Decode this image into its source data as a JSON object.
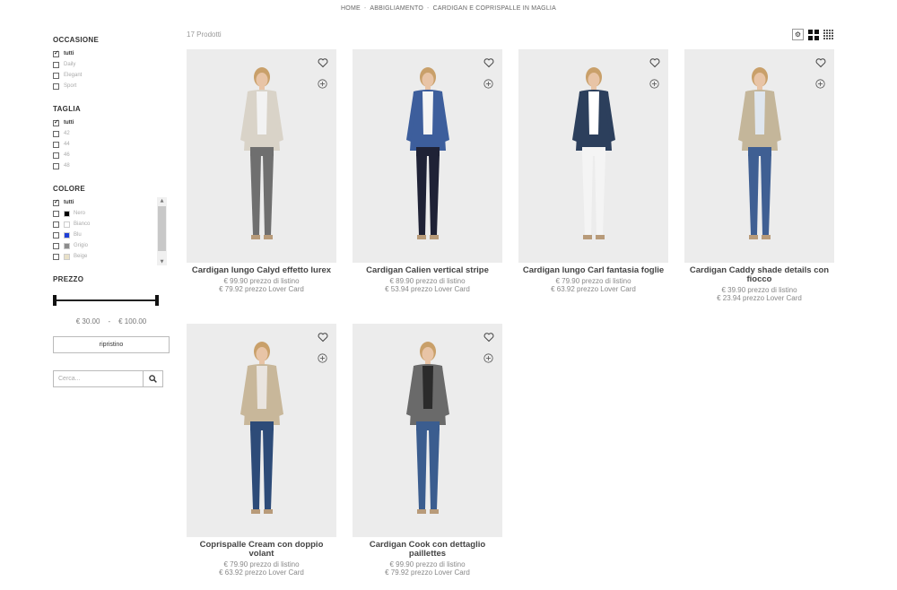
{
  "breadcrumb": [
    "HOME",
    "ABBIGLIAMENTO",
    "CARDIGAN E COPRISPALLE IN MAGLIA"
  ],
  "filters": {
    "occasione": {
      "title": "OCCASIONE",
      "options": [
        {
          "label": "tutti",
          "checked": true
        },
        {
          "label": "Daily",
          "checked": false
        },
        {
          "label": "Elegant",
          "checked": false
        },
        {
          "label": "Sport",
          "checked": false
        }
      ]
    },
    "taglia": {
      "title": "TAGLIA",
      "options": [
        {
          "label": "tutti",
          "checked": true
        },
        {
          "label": "42",
          "checked": false
        },
        {
          "label": "44",
          "checked": false
        },
        {
          "label": "46",
          "checked": false
        },
        {
          "label": "48",
          "checked": false
        }
      ]
    },
    "colore": {
      "title": "COLORE",
      "options": [
        {
          "label": "tutti",
          "checked": true,
          "swatch": null
        },
        {
          "label": "Nero",
          "checked": false,
          "swatch": "#000000"
        },
        {
          "label": "Bianco",
          "checked": false,
          "swatch": "#ffffff"
        },
        {
          "label": "Blu",
          "checked": false,
          "swatch": "#1f3fd6"
        },
        {
          "label": "Grigio",
          "checked": false,
          "swatch": "#8c8c8c"
        },
        {
          "label": "Beige",
          "checked": false,
          "swatch": "#e9e1c8"
        }
      ]
    },
    "prezzo": {
      "title": "PREZZO",
      "min": "€ 30.00",
      "max": "€ 100.00",
      "dash": "-"
    }
  },
  "reset_label": "ripristino",
  "search": {
    "placeholder": "Cerca..."
  },
  "count_label": "17 Prodotti",
  "products": [
    {
      "name": "Cardigan lungo Calyd effetto lurex",
      "list_price": "€ 99.90 prezzo di listino",
      "card_price": "€ 79.92 prezzo Lover Card",
      "top": "#d9d3c8",
      "inner": "#f2f2f2",
      "pants": "#6f6f6f"
    },
    {
      "name": "Cardigan Calien vertical stripe",
      "list_price": "€ 89.90 prezzo di listino",
      "card_price": "€ 53.94 prezzo Lover Card",
      "top": "#3d5e9c",
      "inner": "#f5f5f5",
      "pants": "#1f2236"
    },
    {
      "name": "Cardigan lungo Carl fantasia foglie",
      "list_price": "€ 79.90 prezzo di listino",
      "card_price": "€ 63.92 prezzo Lover Card",
      "top": "#2c3f5c",
      "inner": "#ffffff",
      "pants": "#f4f4f4"
    },
    {
      "name": "Cardigan Caddy shade details con fiocco",
      "list_price": "€ 39.90 prezzo di listino",
      "card_price": "€ 23.94 prezzo Lover Card",
      "top": "#c4b69a",
      "inner": "#dfe6ee",
      "pants": "#3f5f93"
    },
    {
      "name": "Coprispalle Cream con doppio volant",
      "list_price": "€ 79.90 prezzo di listino",
      "card_price": "€ 63.92 prezzo Lover Card",
      "top": "#c8b79a",
      "inner": "#e9e4df",
      "pants": "#2d4b78"
    },
    {
      "name": "Cardigan Cook con dettaglio paillettes",
      "list_price": "€ 99.90 prezzo di listino",
      "card_price": "€ 79.92 prezzo Lover Card",
      "top": "#6a6a6a",
      "inner": "#2b2b2b",
      "pants": "#3b5d8f"
    }
  ]
}
